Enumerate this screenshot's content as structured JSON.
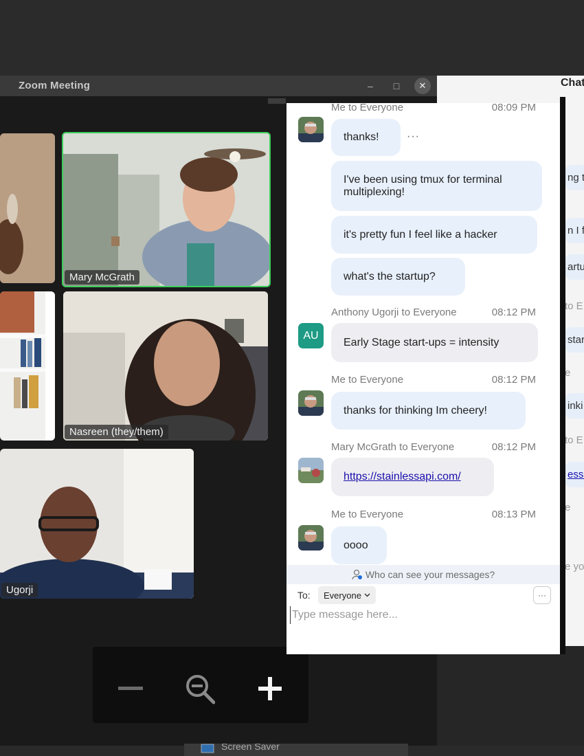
{
  "window": {
    "title": "Zoom Meeting",
    "minimize_glyph": "–",
    "maximize_glyph": "□",
    "close_glyph": "✕"
  },
  "participants": [
    {
      "name": "",
      "tile": "tile-a"
    },
    {
      "name": "Mary McGrath",
      "tile": "tile-mary",
      "active_speaker": true
    },
    {
      "name": "",
      "tile": "tile-b"
    },
    {
      "name": "Nasreen (they/them)",
      "tile": "tile-nasreen"
    },
    {
      "name": "Ugorji",
      "tile": "tile-anthony"
    }
  ],
  "toolbar": {
    "zoom_out_icon": "minus-icon",
    "zoom_icon": "magnifier-zoom-out-icon",
    "zoom_in_icon": "plus-icon"
  },
  "chat": {
    "groups": [
      {
        "sender": "Me to Everyone",
        "time": "08:09 PM",
        "avatar": "me-avatar",
        "messages": [
          "thanks!",
          "I've been using tmux for terminal multiplexing!",
          "it's pretty fun I feel like a hacker",
          "what's the startup?"
        ]
      },
      {
        "sender": "Anthony Ugorji to Everyone",
        "time": "08:12 PM",
        "avatar_text": "AU",
        "avatar_color": "#1d9b84",
        "messages": [
          "Early Stage start-ups = intensity"
        ]
      },
      {
        "sender": "Me to Everyone",
        "time": "08:12 PM",
        "avatar": "me-avatar",
        "messages": [
          "thanks for thinking Im cheery!"
        ]
      },
      {
        "sender": "Mary McGrath to Everyone",
        "time": "08:12 PM",
        "avatar": "mary-avatar",
        "messages": [
          "https://stainlessapi.com/"
        ]
      },
      {
        "sender": "Me to Everyone",
        "time": "08:13 PM",
        "avatar": "me-avatar",
        "messages": [
          "oooo"
        ]
      }
    ],
    "more_dots": "···",
    "visibility_text": "Who can see your messages?",
    "to_label": "To:",
    "recipient": "Everyone",
    "more_button": "···",
    "input_placeholder": "Type message here..."
  },
  "bg_chat": {
    "title": "Chat",
    "fragments": [
      "ng t",
      "n I f",
      "artu",
      "to E",
      "start",
      "e",
      "inki",
      "to E",
      "essa",
      "e",
      "e yo"
    ]
  },
  "taskbar": {
    "label": "Screen Saver"
  },
  "colors": {
    "active_speaker": "#3ccf5a",
    "bubble_blue": "#e8f0fb",
    "link": "#1a0dab"
  }
}
